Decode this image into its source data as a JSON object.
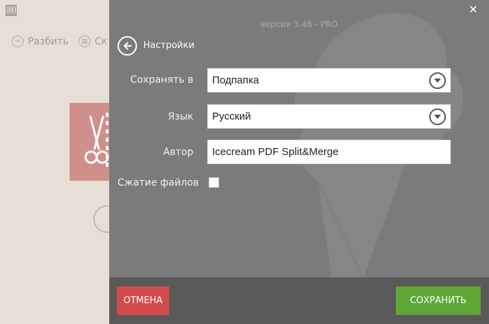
{
  "background_app": {
    "logo_glyph": "ЭП",
    "toolbar": [
      {
        "label": "Разбить",
        "icon": "scissors-icon"
      },
      {
        "label": "Ск",
        "icon": "document-icon"
      }
    ]
  },
  "settings": {
    "version_text": "версия 3.46 - PRO",
    "title": "Настройки",
    "fields": {
      "save_to": {
        "label": "Сохранять в",
        "value": "Подпапка"
      },
      "language": {
        "label": "Язык",
        "value": "Русский"
      },
      "author": {
        "label": "Автор",
        "value": "Icecream PDF Split&Merge"
      },
      "compression": {
        "label": "Сжатие файлов",
        "checked": false
      }
    },
    "buttons": {
      "cancel": "ОТМЕНА",
      "save": "СОХРАНИТЬ"
    }
  },
  "colors": {
    "panel_bg": "#7b7b7b",
    "footer_bg": "#595959",
    "cancel": "#d24b4b",
    "save": "#5ea636"
  }
}
